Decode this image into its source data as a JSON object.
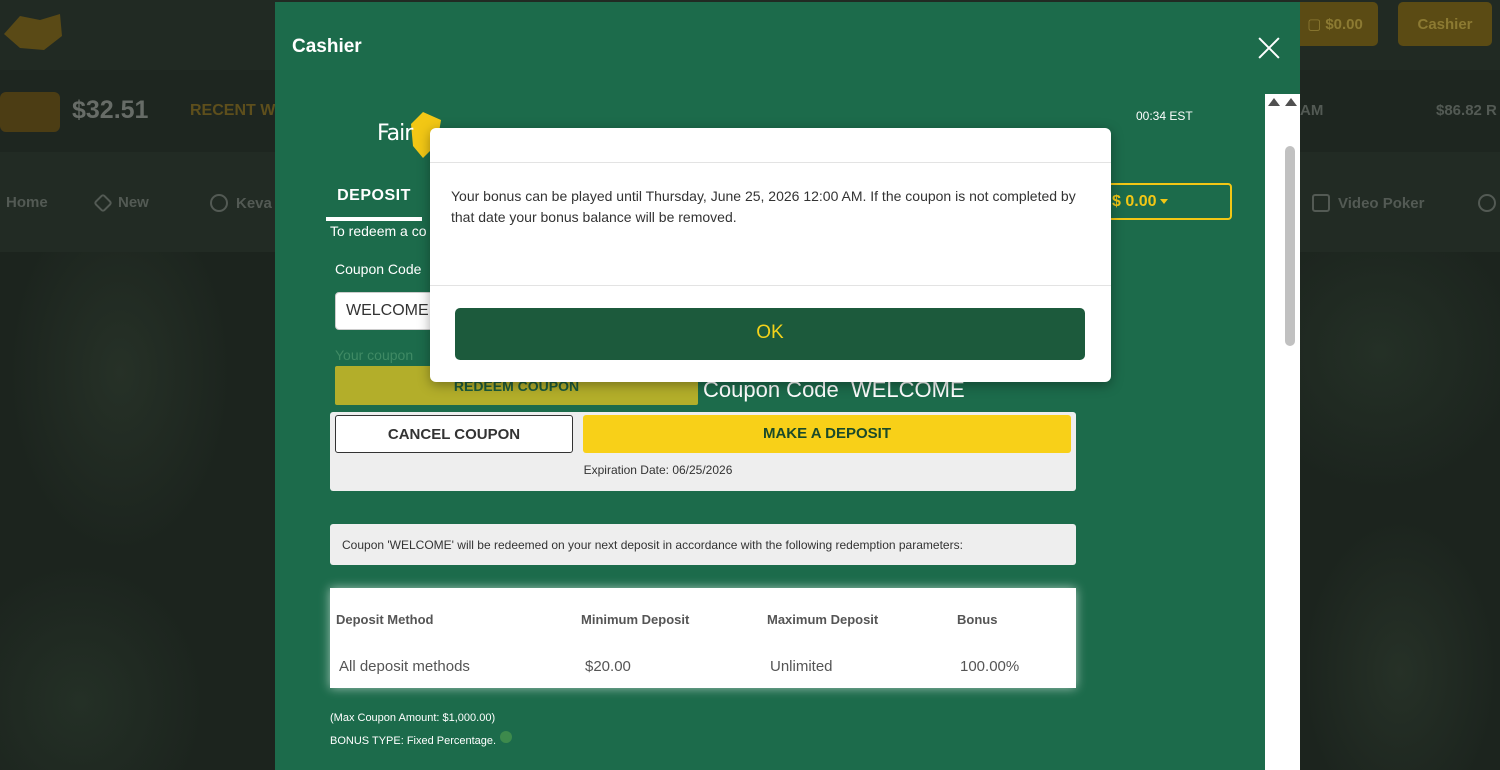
{
  "background": {
    "header": {
      "balance": "$0.00",
      "cashier_button": "Cashier"
    },
    "jackpot": {
      "amount": "$32.51",
      "recent_label": "RECENT W",
      "time_fragment": "AM",
      "right_amount": "$86.82 R"
    },
    "nav": [
      "Home",
      "New",
      "Keva",
      "Video Poker"
    ]
  },
  "cashier": {
    "title": "Cashier",
    "time": "00:34 EST",
    "logo_text": "Fair",
    "tab_deposit": "DEPOSIT",
    "balance": "$ 0.00",
    "redeem_instruction": "To redeem a co",
    "coupon_label": "Coupon Code",
    "coupon_value": "WELCOME",
    "coupon_hint": "Your coupon",
    "redeem_button": "REDEEM COUPON",
    "coupon_code_display": "Coupon Code  WELCOME",
    "cancel_button": "CANCEL COUPON",
    "deposit_button": "MAKE A DEPOSIT",
    "expiration": "Expiration Date: 06/25/2026",
    "redeem_note": "Coupon 'WELCOME' will be redeemed on your next deposit in accordance with the following redemption parameters:",
    "table": {
      "headers": [
        "Deposit Method",
        "Minimum Deposit",
        "Maximum Deposit",
        "Bonus"
      ],
      "rows": [
        [
          "All deposit methods",
          "$20.00",
          "Unlimited",
          "100.00%"
        ]
      ]
    },
    "max_coupon": "(Max Coupon Amount: $1,000.00)",
    "bonus_type": "BONUS TYPE: Fixed Percentage."
  },
  "dialog": {
    "message": "Your bonus can be played until Thursday, June 25, 2026 12:00 AM. If the coupon is not completed by that date your bonus balance will be removed.",
    "ok_button": "OK"
  },
  "colors": {
    "green": "#1c6b4b",
    "yellow": "#f8d018",
    "dark_green": "#1c5a3c"
  }
}
